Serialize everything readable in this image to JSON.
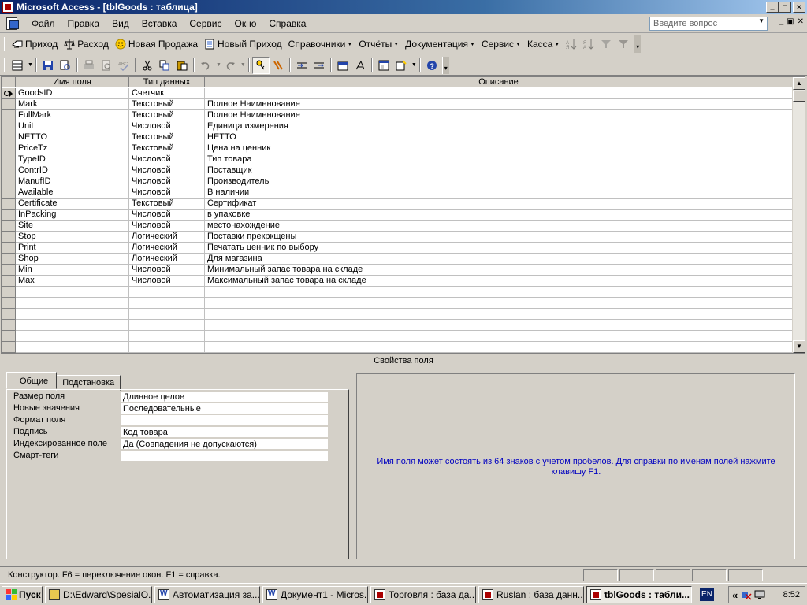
{
  "window": {
    "title": "Microsoft Access - [tblGoods : таблица]"
  },
  "menu": [
    "Файл",
    "Правка",
    "Вид",
    "Вставка",
    "Сервис",
    "Окно",
    "Справка"
  ],
  "ask": {
    "placeholder": "Введите вопрос"
  },
  "custom_toolbar": [
    {
      "label": "Приход",
      "icon": "incoming-icon"
    },
    {
      "label": "Расход",
      "icon": "scales-icon"
    },
    {
      "label": "Новая Продажа",
      "icon": "smiley-icon"
    },
    {
      "label": "Новый Приход",
      "icon": "document-grid-icon"
    },
    {
      "label": "Справочники",
      "dropdown": true
    },
    {
      "label": "Отчёты",
      "dropdown": true
    },
    {
      "label": "Документация",
      "dropdown": true
    },
    {
      "label": "Сервис",
      "dropdown": true
    },
    {
      "label": "Касса",
      "dropdown": true
    }
  ],
  "grid": {
    "headers": {
      "name": "Имя поля",
      "type": "Тип данных",
      "description": "Описание"
    },
    "rows": [
      {
        "name": "GoodsID",
        "type": "Счетчик",
        "description": ""
      },
      {
        "name": "Mark",
        "type": "Текстовый",
        "description": "Полное Наименование"
      },
      {
        "name": "FullMark",
        "type": "Текстовый",
        "description": "Полное Наименование"
      },
      {
        "name": "Unit",
        "type": "Числовой",
        "description": "Единица измерения"
      },
      {
        "name": "NETTO",
        "type": "Текстовый",
        "description": "НЕТТО"
      },
      {
        "name": "PriceTz",
        "type": "Текстовый",
        "description": "Цена на ценник"
      },
      {
        "name": "TypeID",
        "type": "Числовой",
        "description": "Тип товара"
      },
      {
        "name": "ContrID",
        "type": "Числовой",
        "description": "Поставщик"
      },
      {
        "name": "ManufID",
        "type": "Числовой",
        "description": "Производитель"
      },
      {
        "name": "Available",
        "type": "Числовой",
        "description": "В наличии"
      },
      {
        "name": "Certificate",
        "type": "Текстовый",
        "description": "Сертификат"
      },
      {
        "name": "InPacking",
        "type": "Числовой",
        "description": "в упаковке"
      },
      {
        "name": "Site",
        "type": "Числовой",
        "description": "местонахождение"
      },
      {
        "name": "Stop",
        "type": "Логический",
        "description": "Поставки прекркщены"
      },
      {
        "name": "Print",
        "type": "Логический",
        "description": "Печатать ценник по выбору"
      },
      {
        "name": "Shop",
        "type": "Логический",
        "description": "Для магазина"
      },
      {
        "name": "Min",
        "type": "Числовой",
        "description": "Минимальный запас товара на складе"
      },
      {
        "name": "Max",
        "type": "Числовой",
        "description": "Максимальный запас товара на складе"
      }
    ],
    "empty_rows": 6
  },
  "properties": {
    "title": "Свойства поля",
    "tabs": [
      "Общие",
      "Подстановка"
    ],
    "items": [
      {
        "label": "Размер поля",
        "value": "Длинное целое"
      },
      {
        "label": "Новые значения",
        "value": "Последовательные"
      },
      {
        "label": "Формат поля",
        "value": ""
      },
      {
        "label": "Подпись",
        "value": "Код товара"
      },
      {
        "label": "Индексированное поле",
        "value": "Да (Совпадения не допускаются)"
      },
      {
        "label": "Смарт-теги",
        "value": ""
      }
    ],
    "hint": "Имя поля может состоять из 64 знаков с учетом пробелов.  Для справки по именам полей нажмите клавишу F1."
  },
  "status": {
    "text": "Конструктор.  F6 = переключение окон.  F1 = справка."
  },
  "taskbar": {
    "start": "Пуск",
    "tasks": [
      {
        "label": "D:\\Edward\\SpesialO...",
        "icon": "folder-icon",
        "width": 136
      },
      {
        "label": "Автоматизация за...",
        "icon": "word-icon",
        "width": 134
      },
      {
        "label": "Документ1 - Micros...",
        "icon": "word-icon",
        "width": 134
      },
      {
        "label": "Торговля : база да...",
        "icon": "access-icon",
        "width": 134
      },
      {
        "label": "Ruslan : база данн...",
        "icon": "access-icon",
        "width": 134
      },
      {
        "label": "tblGoods : табли...",
        "icon": "access-icon",
        "width": 134,
        "active": true
      }
    ],
    "lang": "EN",
    "clock": "8:52"
  },
  "colors": {
    "title_bar": "#0a246a",
    "hint_text": "#0000c0",
    "face": "#d4d0c8"
  }
}
